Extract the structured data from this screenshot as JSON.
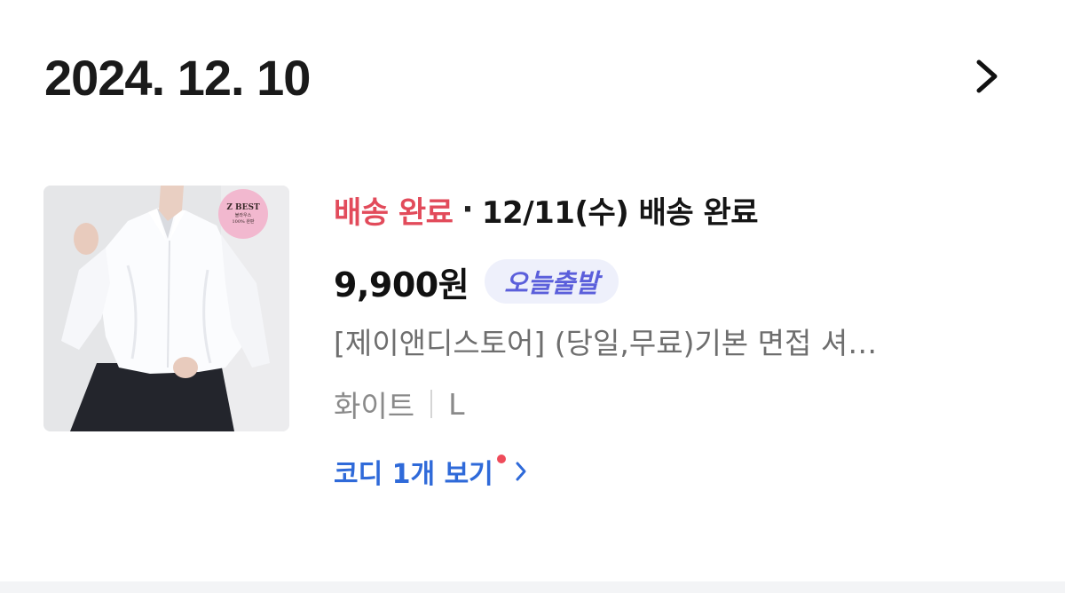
{
  "order": {
    "date": "2024. 12. 10",
    "chevron_icon": "chevron-right-icon"
  },
  "item": {
    "image_badge": {
      "title": "Z BEST",
      "sub1": "블라우스",
      "sub2": "100% 완판"
    },
    "status": "배송 완료",
    "status_separator": "·",
    "status_detail": "12/11(수) 배송 완료",
    "price": "9,900원",
    "tag": "오늘출발",
    "name": "[제이앤디스토어] (당일,무료)기본 면접 셔…",
    "option_color": "화이트",
    "option_size": "L",
    "coordi_link": "코디 1개 보기"
  },
  "colors": {
    "status_red": "#e24b5b",
    "tag_bg": "#eef0fb",
    "tag_text": "#5b5fdb",
    "link_blue": "#2f6ad9",
    "dot_red": "#ef4b5a"
  }
}
